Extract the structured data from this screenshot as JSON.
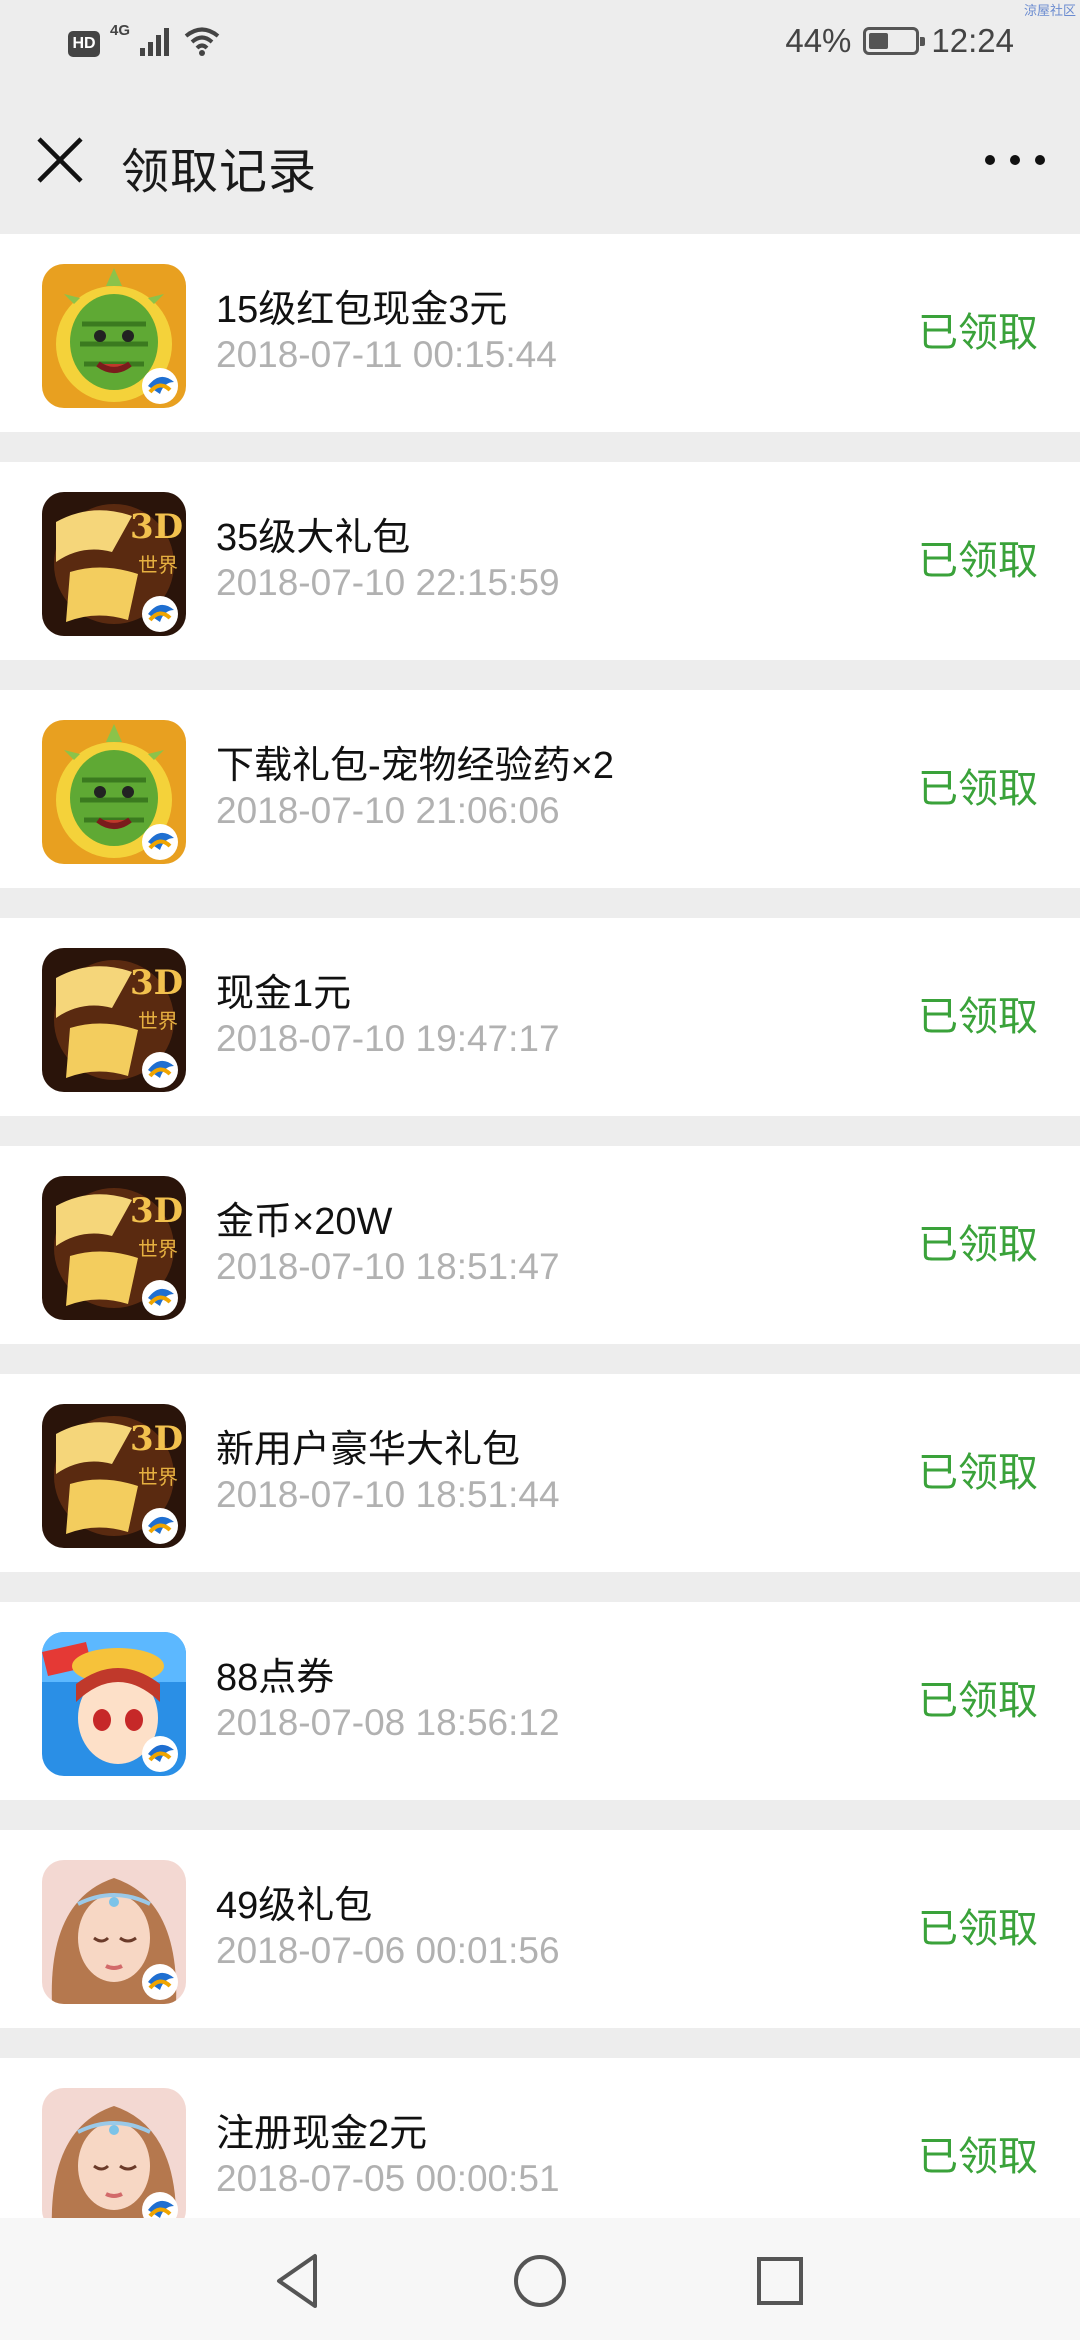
{
  "status_bar": {
    "hd": "HD",
    "network": "4G",
    "battery": "44%",
    "battery_level": 0.44,
    "time": "12:24",
    "watermark": "涼屋社区"
  },
  "header": {
    "title": "领取记录"
  },
  "colors": {
    "status_green": "#3aa23a",
    "time_gray": "#b1b1b1",
    "background": "#ededed"
  },
  "icons": {
    "close": "close-icon",
    "more": "more-icon",
    "nav_back": "back-triangle-icon",
    "nav_home": "home-circle-icon",
    "nav_recent": "recent-square-icon"
  },
  "records": [
    {
      "name": "15级红包现金3元",
      "time": "2018-07-11 00:15:44",
      "status": "已领取",
      "icon": "cactus-game-icon"
    },
    {
      "name": "35级大礼包",
      "time": "2018-07-10 22:15:59",
      "status": "已领取",
      "icon": "chuanqi-game-icon"
    },
    {
      "name": "下载礼包-宠物经验药×2",
      "time": "2018-07-10 21:06:06",
      "status": "已领取",
      "icon": "cactus-game-icon"
    },
    {
      "name": "现金1元",
      "time": "2018-07-10 19:47:17",
      "status": "已领取",
      "icon": "chuanqi-game-icon"
    },
    {
      "name": "金币×20W",
      "time": "2018-07-10 18:51:47",
      "status": "已领取",
      "icon": "chuanqi-game-icon"
    },
    {
      "name": "新用户豪华大礼包",
      "time": "2018-07-10 18:51:44",
      "status": "已领取",
      "icon": "chuanqi-game-icon"
    },
    {
      "name": "88点券",
      "time": "2018-07-08 18:56:12",
      "status": "已领取",
      "icon": "racing-girl-game-icon"
    },
    {
      "name": "49级礼包",
      "time": "2018-07-06 00:01:56",
      "status": "已领取",
      "icon": "fairy-girl-game-icon"
    },
    {
      "name": "注册现金2元",
      "time": "2018-07-05 00:00:51",
      "status": "已领取",
      "icon": "fairy-girl-game-icon"
    }
  ]
}
